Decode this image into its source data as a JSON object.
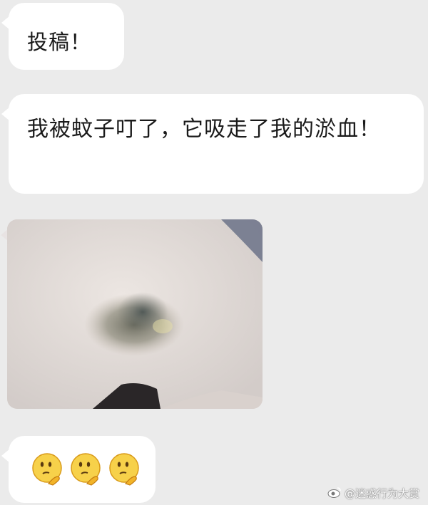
{
  "chat": {
    "messages": [
      {
        "type": "text",
        "text": "投稿！"
      },
      {
        "type": "text",
        "text": "我被蚊子叮了，它吸走了我的淤血！"
      },
      {
        "type": "image",
        "description_icon": "bruise-photo"
      },
      {
        "type": "emoji",
        "emojis": [
          "thinking-face-icon",
          "thinking-face-icon",
          "thinking-face-icon"
        ]
      }
    ]
  },
  "watermark": {
    "text": "@迷惑行为大赏",
    "icon": "weibo-logo-icon"
  },
  "colors": {
    "background": "#ebebeb",
    "bubble": "#ffffff",
    "text": "#1a1a1a"
  }
}
